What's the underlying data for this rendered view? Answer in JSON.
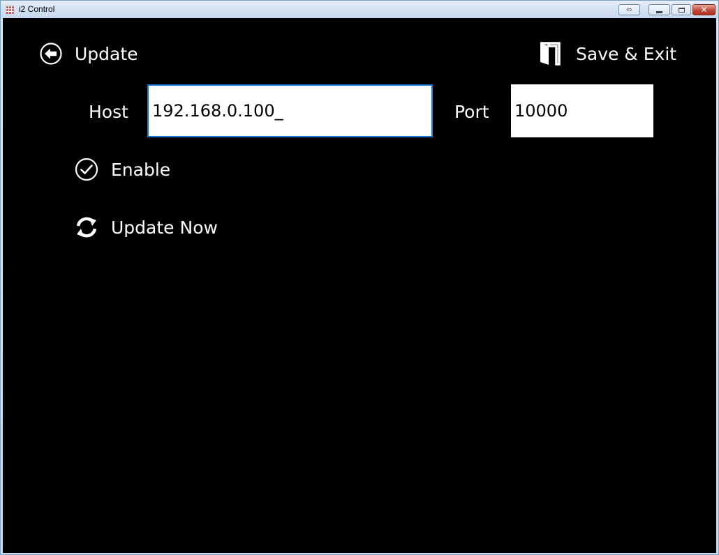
{
  "window": {
    "title": "i2 Control",
    "close_glyph": "✕"
  },
  "header": {
    "back_label": "Update",
    "save_exit_label": "Save & Exit"
  },
  "connection": {
    "host_label": "Host",
    "host_value": "192.168.0.100_",
    "port_label": "Port",
    "port_value": "10000"
  },
  "actions": {
    "enable_label": "Enable",
    "update_now_label": "Update Now"
  },
  "colors": {
    "background": "#000000",
    "text": "#ffffff",
    "focus_border": "#1c78d6"
  },
  "icons": {
    "back": "back-arrow-circle-icon",
    "save_exit": "door-exit-icon",
    "enable": "checkmark-circle-icon",
    "update_now": "refresh-icon"
  }
}
